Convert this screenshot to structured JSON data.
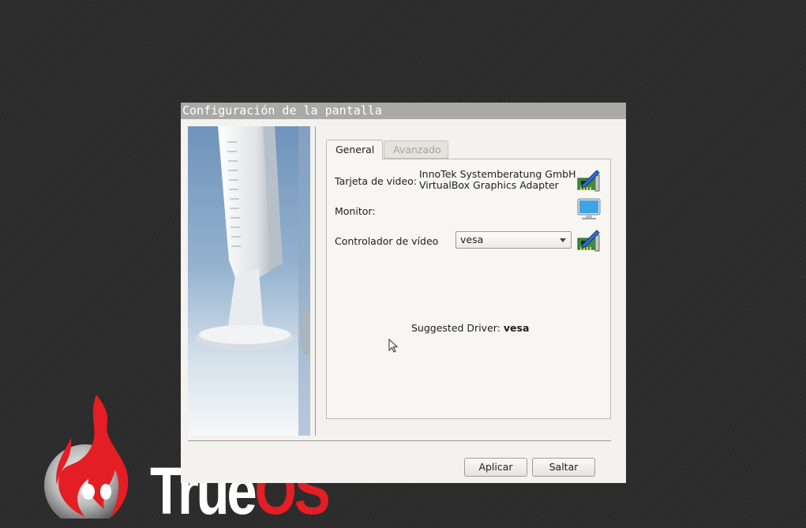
{
  "window": {
    "title": "Configuración de la pantalla"
  },
  "tabs": [
    {
      "label": "General",
      "active": true
    },
    {
      "label": "Avanzado",
      "active": false
    }
  ],
  "fields": {
    "video_card_label": "Tarjeta de video:",
    "video_card_value_line1": "InnoTek Systemberatung GmbH",
    "video_card_value_line2": "VirtualBox Graphics Adapter",
    "monitor_label": "Monitor:",
    "driver_label": "Controlador de vídeo",
    "driver_value": "vesa"
  },
  "suggested": {
    "label": "Suggested Driver:",
    "value": "vesa"
  },
  "buttons": {
    "apply": "Aplicar",
    "skip": "Saltar"
  },
  "icons": [
    "edit-card-icon",
    "monitor-icon",
    "edit-driver-icon",
    "chevron-down-icon",
    "mouse-pointer-icon",
    "flame-logo-icon"
  ],
  "logo": {
    "text_true": "True",
    "text_os": "OS"
  },
  "colors": {
    "titlebar": "#a9a9a7",
    "window_bg": "#f4f2ef",
    "logo_red": "#e31e24",
    "desktop": "#2d2d2d"
  }
}
